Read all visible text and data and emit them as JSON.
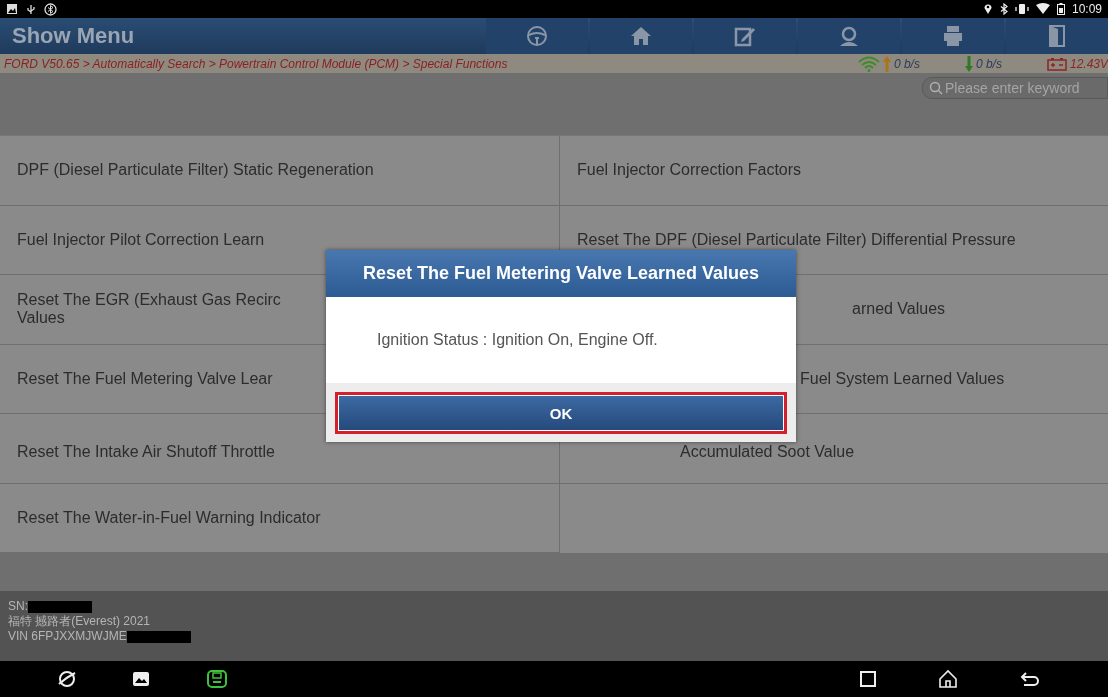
{
  "status_bar": {
    "time": "10:09"
  },
  "header": {
    "title": "Show Menu"
  },
  "breadcrumb": {
    "path": "FORD V50.65 > Automatically Search > Powertrain Control Module (PCM) > Special Functions",
    "upload": "0 b/s",
    "download": "0 b/s",
    "voltage": "12.43V"
  },
  "search": {
    "placeholder": "Please enter keyword"
  },
  "functions": [
    {
      "lines": [
        "DPF (Diesel Particulate Filter) Static Regeneration"
      ]
    },
    {
      "lines": [
        "Fuel Injector Correction Factors"
      ]
    },
    {
      "lines": [
        "Fuel Injector Pilot Correction Learn"
      ]
    },
    {
      "lines": [
        "Reset The DPF (Diesel Particulate Filter) Differential Pressure"
      ]
    },
    {
      "lines": [
        "Reset The EGR (Exhaust Gas Recirc",
        "Values"
      ]
    },
    {
      "lines": [
        "arned Values"
      ]
    },
    {
      "lines": [
        "Reset The Fuel Metering Valve Lear"
      ]
    },
    {
      "lines": [
        "Fuel System Learned Values"
      ]
    },
    {
      "lines": [
        "Reset The Intake Air Shutoff Throttle"
      ]
    },
    {
      "lines": [
        "Accumulated Soot Value"
      ]
    },
    {
      "lines": [
        "Reset The Water-in-Fuel Warning Indicator"
      ]
    }
  ],
  "vehicle": {
    "sn_label": "SN:",
    "model": "福特 撼路者(Everest) 2021",
    "vin": "VIN 6FPJXXMJWJME"
  },
  "dialog": {
    "title": "Reset The Fuel Metering Valve Learned Values",
    "message": "Ignition Status : Ignition On, Engine Off.",
    "button": "OK"
  }
}
